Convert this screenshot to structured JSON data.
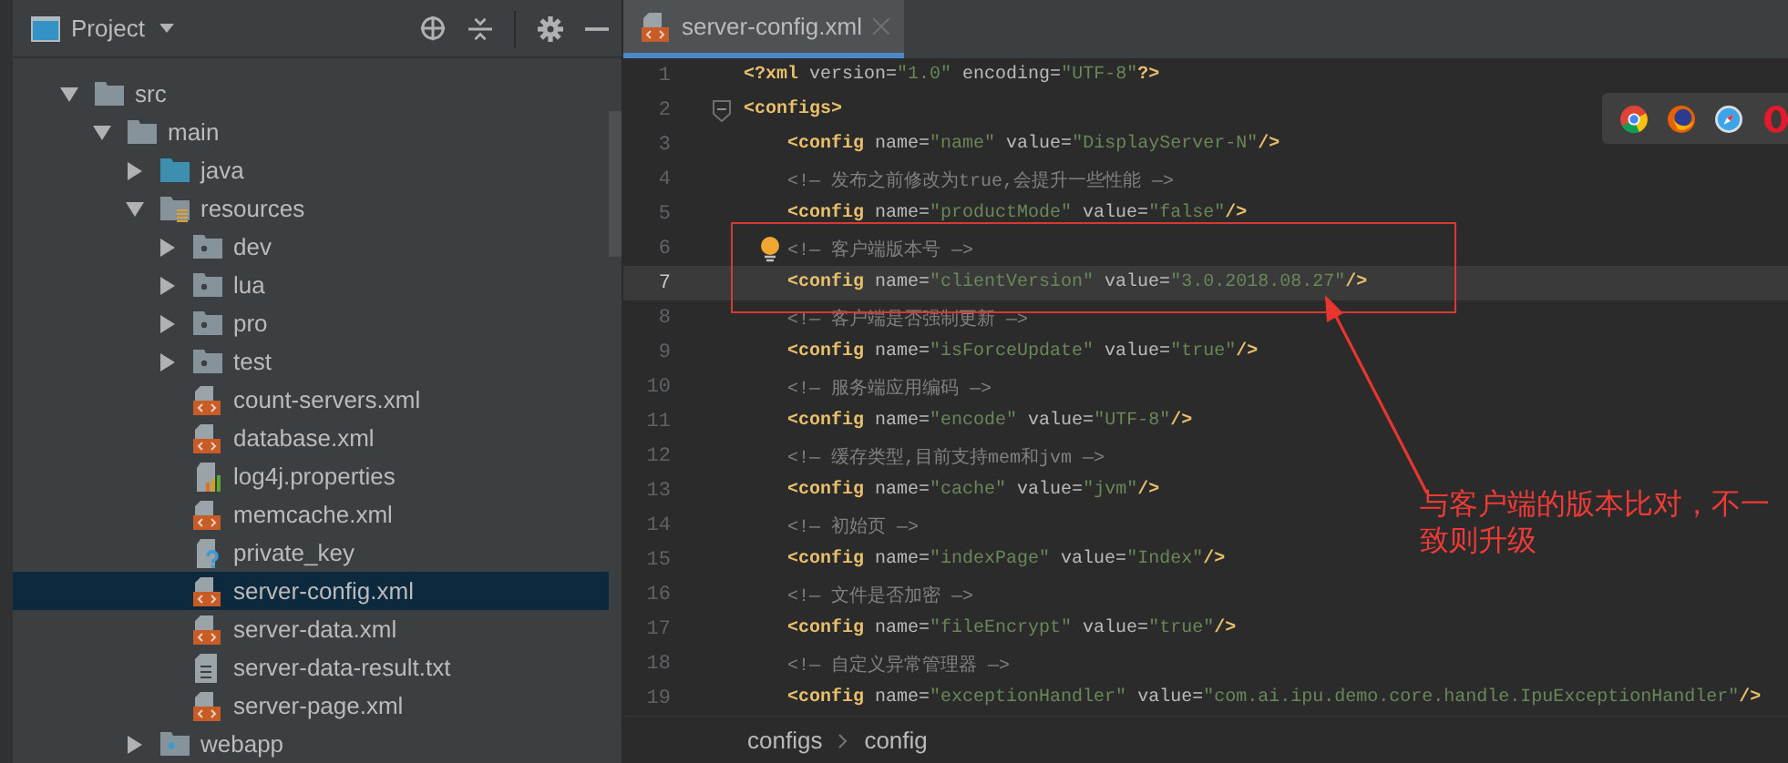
{
  "project_panel": {
    "title": "Project",
    "tree": [
      {
        "name": "src",
        "kind": "folder",
        "expanded": true,
        "selected": false,
        "children": [
          {
            "name": "main",
            "kind": "folder",
            "expanded": true,
            "selected": false,
            "children": [
              {
                "name": "java",
                "kind": "source-folder",
                "expanded": false,
                "selected": false
              },
              {
                "name": "resources",
                "kind": "resources-folder",
                "expanded": true,
                "selected": false,
                "children": [
                  {
                    "name": "dev",
                    "kind": "package-folder",
                    "expanded": false,
                    "selected": false
                  },
                  {
                    "name": "lua",
                    "kind": "package-folder",
                    "expanded": false,
                    "selected": false
                  },
                  {
                    "name": "pro",
                    "kind": "package-folder",
                    "expanded": false,
                    "selected": false
                  },
                  {
                    "name": "test",
                    "kind": "package-folder",
                    "expanded": false,
                    "selected": false
                  },
                  {
                    "name": "count-servers.xml",
                    "kind": "xml",
                    "selected": false
                  },
                  {
                    "name": "database.xml",
                    "kind": "xml",
                    "selected": false
                  },
                  {
                    "name": "log4j.properties",
                    "kind": "properties",
                    "selected": false
                  },
                  {
                    "name": "memcache.xml",
                    "kind": "xml",
                    "selected": false
                  },
                  {
                    "name": "private_key",
                    "kind": "unknown",
                    "selected": false
                  },
                  {
                    "name": "server-config.xml",
                    "kind": "xml",
                    "selected": true
                  },
                  {
                    "name": "server-data.xml",
                    "kind": "xml",
                    "selected": false
                  },
                  {
                    "name": "server-data-result.txt",
                    "kind": "text",
                    "selected": false
                  },
                  {
                    "name": "server-page.xml",
                    "kind": "xml",
                    "selected": false
                  }
                ]
              },
              {
                "name": "webapp",
                "kind": "web-folder",
                "expanded": false,
                "selected": false
              }
            ]
          }
        ]
      }
    ]
  },
  "editor": {
    "tabs": [
      {
        "label": "server-config.xml",
        "selected": true
      }
    ],
    "lines": [
      {
        "number": "1",
        "tokens": [
          {
            "kind": "tag",
            "text": "<?xml "
          },
          {
            "kind": "attr",
            "text": "version="
          },
          {
            "kind": "string",
            "text": "\"1.0\""
          },
          {
            "kind": "attr",
            "text": " encoding="
          },
          {
            "kind": "string",
            "text": "\"UTF-8\""
          },
          {
            "kind": "tag",
            "text": "?>"
          }
        ]
      },
      {
        "number": "2",
        "fold": true,
        "tokens": [
          {
            "kind": "tag",
            "text": "<configs>"
          }
        ],
        "children": [
          {
            "number": "3",
            "tokens": [
              {
                "kind": "tag",
                "text": "<config "
              },
              {
                "kind": "attr",
                "text": "name="
              },
              {
                "kind": "string",
                "text": "\"name\""
              },
              {
                "kind": "attr",
                "text": " value="
              },
              {
                "kind": "string",
                "text": "\"DisplayServer-N\""
              },
              {
                "kind": "tag",
                "text": "/>"
              }
            ]
          },
          {
            "number": "4",
            "tokens": [
              {
                "kind": "comment",
                "text": "<!— 发布之前修改为true,会提升一些性能 —>"
              }
            ]
          },
          {
            "number": "5",
            "tokens": [
              {
                "kind": "tag",
                "text": "<config "
              },
              {
                "kind": "attr",
                "text": "name="
              },
              {
                "kind": "string",
                "text": "\"productMode\""
              },
              {
                "kind": "attr",
                "text": " value="
              },
              {
                "kind": "string",
                "text": "\"false\""
              },
              {
                "kind": "tag",
                "text": "/>"
              }
            ]
          },
          {
            "number": "6",
            "bulb": true,
            "tokens": [
              {
                "kind": "comment",
                "text": "<!— 客户端版本号 —>"
              }
            ]
          },
          {
            "number": "7",
            "current": true,
            "tokens": [
              {
                "kind": "tag",
                "text": "<config "
              },
              {
                "kind": "attr",
                "text": "name="
              },
              {
                "kind": "string",
                "text": "\"clientVersion\""
              },
              {
                "kind": "attr",
                "text": " value="
              },
              {
                "kind": "string",
                "text": "\"3.0.2018.08.27\""
              },
              {
                "kind": "tag",
                "text": "/>"
              }
            ]
          },
          {
            "number": "8",
            "tokens": [
              {
                "kind": "comment",
                "text": "<!— 客户端是否强制更新 —>"
              }
            ]
          },
          {
            "number": "9",
            "tokens": [
              {
                "kind": "tag",
                "text": "<config "
              },
              {
                "kind": "attr",
                "text": "name="
              },
              {
                "kind": "string",
                "text": "\"isForceUpdate\""
              },
              {
                "kind": "attr",
                "text": " value="
              },
              {
                "kind": "string",
                "text": "\"true\""
              },
              {
                "kind": "tag",
                "text": "/>"
              }
            ]
          },
          {
            "number": "10",
            "tokens": [
              {
                "kind": "comment",
                "text": "<!— 服务端应用编码 —>"
              }
            ]
          },
          {
            "number": "11",
            "tokens": [
              {
                "kind": "tag",
                "text": "<config "
              },
              {
                "kind": "attr",
                "text": "name="
              },
              {
                "kind": "string",
                "text": "\"encode\""
              },
              {
                "kind": "attr",
                "text": " value="
              },
              {
                "kind": "string",
                "text": "\"UTF-8\""
              },
              {
                "kind": "tag",
                "text": "/>"
              }
            ]
          },
          {
            "number": "12",
            "tokens": [
              {
                "kind": "comment",
                "text": "<!— 缓存类型,目前支持mem和jvm —>"
              }
            ]
          },
          {
            "number": "13",
            "tokens": [
              {
                "kind": "tag",
                "text": "<config "
              },
              {
                "kind": "attr",
                "text": "name="
              },
              {
                "kind": "string",
                "text": "\"cache\""
              },
              {
                "kind": "attr",
                "text": " value="
              },
              {
                "kind": "string",
                "text": "\"jvm\""
              },
              {
                "kind": "tag",
                "text": "/>"
              }
            ]
          },
          {
            "number": "14",
            "tokens": [
              {
                "kind": "comment",
                "text": "<!— 初始页 —>"
              }
            ]
          },
          {
            "number": "15",
            "tokens": [
              {
                "kind": "tag",
                "text": "<config "
              },
              {
                "kind": "attr",
                "text": "name="
              },
              {
                "kind": "string",
                "text": "\"indexPage\""
              },
              {
                "kind": "attr",
                "text": " value="
              },
              {
                "kind": "string",
                "text": "\"Index\""
              },
              {
                "kind": "tag",
                "text": "/>"
              }
            ]
          },
          {
            "number": "16",
            "tokens": [
              {
                "kind": "comment",
                "text": "<!— 文件是否加密 —>"
              }
            ]
          },
          {
            "number": "17",
            "tokens": [
              {
                "kind": "tag",
                "text": "<config "
              },
              {
                "kind": "attr",
                "text": "name="
              },
              {
                "kind": "string",
                "text": "\"fileEncrypt\""
              },
              {
                "kind": "attr",
                "text": " value="
              },
              {
                "kind": "string",
                "text": "\"true\""
              },
              {
                "kind": "tag",
                "text": "/>"
              }
            ]
          },
          {
            "number": "18",
            "tokens": [
              {
                "kind": "comment",
                "text": "<!— 自定义异常管理器 —>"
              }
            ]
          },
          {
            "number": "19",
            "tokens": [
              {
                "kind": "tag",
                "text": "<config "
              },
              {
                "kind": "attr",
                "text": "name="
              },
              {
                "kind": "string",
                "text": "\"exceptionHandler\""
              },
              {
                "kind": "attr",
                "text": " value="
              },
              {
                "kind": "string",
                "text": "\"com.ai.ipu.demo.core.handle.IpuExceptionHandler\""
              },
              {
                "kind": "tag",
                "text": "/>"
              }
            ]
          }
        ]
      }
    ],
    "breadcrumbs": [
      "configs",
      "config"
    ]
  },
  "annotation": {
    "text": "与客户端的版本比对，不一致则升级"
  },
  "browser_bar": {
    "browsers": [
      {
        "kind": "chrome"
      },
      {
        "kind": "firefox"
      },
      {
        "kind": "safari"
      },
      {
        "kind": "opera"
      }
    ]
  }
}
